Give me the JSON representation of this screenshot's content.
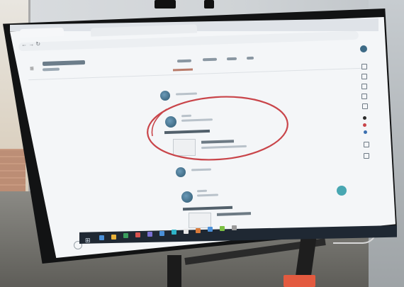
{
  "photo": {
    "subject": "interactive-display",
    "accent_colors": {
      "annotation": "#c9454a",
      "fab": "#48a7b2",
      "taskbar": "#1f2833",
      "avatar": "#2e5870"
    }
  },
  "screen": {
    "browser": {
      "tabs": [
        {
          "label": ""
        },
        {
          "label": ""
        }
      ],
      "address": ""
    },
    "classroom": {
      "title": "",
      "subtitle": "",
      "nav": [
        "",
        "",
        "",
        ""
      ]
    },
    "icons": [
      "menu-icon",
      "add-icon",
      "help-icon",
      "windows-start-icon"
    ],
    "annotation": "red-circle"
  }
}
